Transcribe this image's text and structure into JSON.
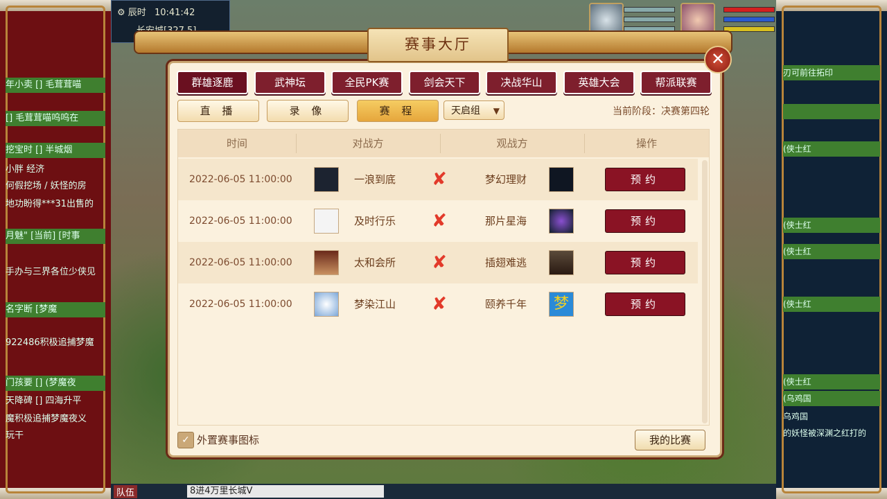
{
  "hud": {
    "time_label": "辰时",
    "clock": "10:41:42",
    "location": "长安城[327,5]"
  },
  "dialog": {
    "title": "赛事大厅",
    "close_label": "✕",
    "categories": [
      "群雄逐鹿",
      "武神坛",
      "全民PK赛",
      "剑会天下",
      "决战华山",
      "英雄大会",
      "帮派联赛"
    ],
    "active_category": "群雄逐鹿",
    "subtabs": [
      "直 播",
      "录 像",
      "赛 程"
    ],
    "active_subtab": "赛 程",
    "group_dropdown": "天启组",
    "stage": "当前阶段：决赛第四轮",
    "columns": [
      "时间",
      "对战方",
      "观战方",
      "操作"
    ],
    "rows": [
      {
        "time": "2022-06-05 11:00:00",
        "home": "一浪到底",
        "away": "梦幻理财",
        "action": "预约"
      },
      {
        "time": "2022-06-05 11:00:00",
        "home": "及时行乐",
        "away": "那片星海",
        "action": "预约"
      },
      {
        "time": "2022-06-05 11:00:00",
        "home": "太和会所",
        "away": "插翅难逃",
        "action": "预约"
      },
      {
        "time": "2022-06-05 11:00:00",
        "home": "梦染江山",
        "away": "颐养千年",
        "action": "预约"
      }
    ],
    "show_icon_label": "外置赛事图标",
    "show_icon_checked": true,
    "my_games_label": "我的比赛"
  },
  "chat_left": [
    "年小卖 [] 毛茸茸喵",
    "[] 毛茸茸喵呜呜在",
    "挖宝时 [] 半城烟",
    "小胖 经济",
    "何假挖场 / 妖怪的房",
    "地功盼得***31出售的",
    "月魅\" [当前] [时事",
    "手办与三界各位少侠见",
    "名字断 [梦魔",
    "922486积极追捕梦魔",
    "门孩要 [] (梦魔夜",
    "天降碑 [] 四海升平",
    "魔积极追捕梦魔夜义",
    "玩干"
  ],
  "chat_right": [
    "刃可前往拓印",
    "",
    "(侠士红",
    "(侠士红",
    "(侠士红",
    "(侠士红",
    "(侠士红",
    "(乌鸡国",
    "乌鸡国",
    "的妖怪被深渊之红打的"
  ],
  "bottom": {
    "team": "队伍",
    "chat_input": "8进4万里长城V"
  },
  "colors": {
    "category_bg": "#7e1f2d",
    "book_bg": "#8a1324",
    "vs_color": "#e23a2a",
    "panel_bg": "#fbf1de"
  }
}
